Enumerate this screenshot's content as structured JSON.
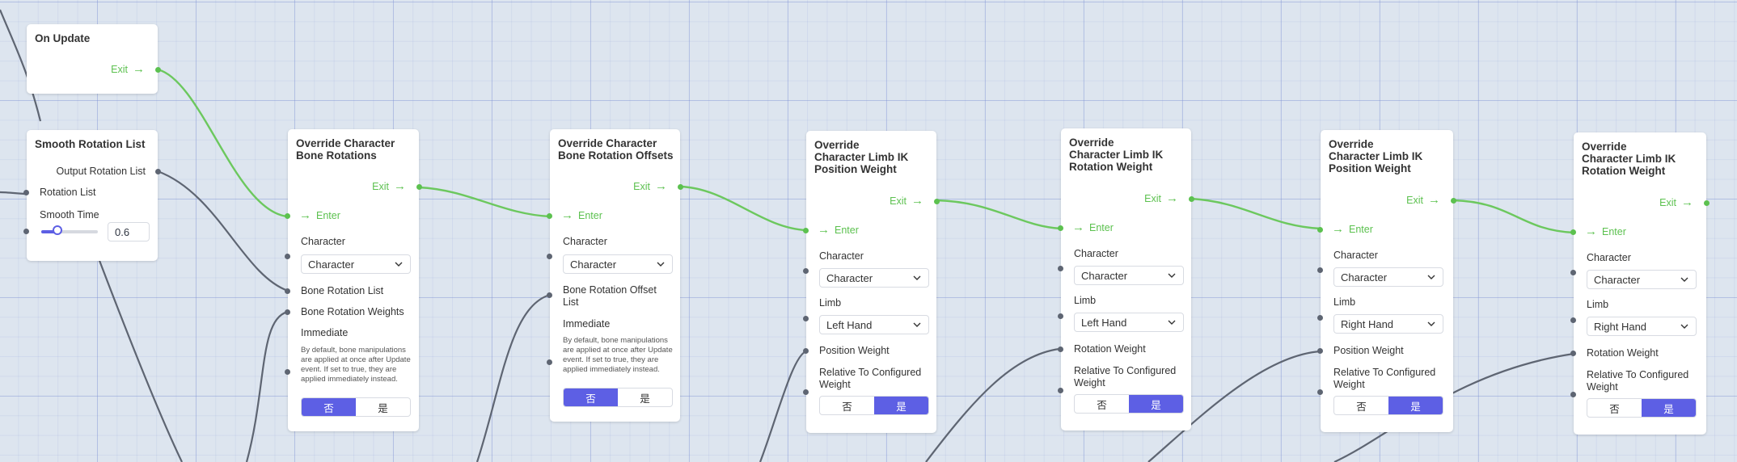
{
  "colors": {
    "exec_wire": "#6cc85e",
    "data_wire": "#5e6572",
    "toggle_on": "#5d5fe4",
    "grid": "#dde5ef"
  },
  "icons": {
    "exec_arrow": "arrow-right-icon",
    "dropdown": "chevron-down-icon"
  },
  "on_update": {
    "title": "On Update",
    "exit": "Exit"
  },
  "smooth": {
    "title": "Smooth Rotation List",
    "output": "Output Rotation List",
    "input": "Rotation List",
    "time_label": "Smooth Time",
    "time_value": "0.6",
    "slider_fraction": 0.3
  },
  "common": {
    "enter": "Enter",
    "exit": "Exit",
    "character": "Character",
    "limb": "Limb",
    "no": "否",
    "yes": "是"
  },
  "node1": {
    "title": "Override Character Bone Rotations",
    "select": "Character",
    "list": "Bone Rotation List",
    "weights": "Bone Rotation Weights",
    "immediate": "Immediate",
    "desc": "By default, bone manipulations are applied at once after Update event. If set to true, they are applied immediately instead.",
    "selected": "否"
  },
  "node2": {
    "title": "Override Character Bone Rotation Offsets",
    "select": "Character",
    "list": "Bone Rotation Offset List",
    "immediate": "Immediate",
    "desc": "By default, bone manipulations are applied at once after Update event. If set to true, they are applied immediately instead.",
    "selected": "否"
  },
  "node3": {
    "title": "Override Character Limb IK Position Weight",
    "select": "Character",
    "limb": "Left Hand",
    "weight": "Position Weight",
    "relative": "Relative To Configured Weight",
    "selected": "是"
  },
  "node4": {
    "title": "Override Character Limb IK Rotation Weight",
    "select": "Character",
    "limb": "Left Hand",
    "weight": "Rotation Weight",
    "relative": "Relative To Configured Weight",
    "selected": "是"
  },
  "node5": {
    "title": "Override Character Limb IK Position Weight",
    "select": "Character",
    "limb": "Right Hand",
    "weight": "Position Weight",
    "relative": "Relative To Configured Weight",
    "selected": "是"
  },
  "node6": {
    "title": "Override Character Limb IK Rotation Weight",
    "select": "Character",
    "limb": "Right Hand",
    "weight": "Rotation Weight",
    "relative": "Relative To Configured Weight",
    "selected": "是"
  }
}
